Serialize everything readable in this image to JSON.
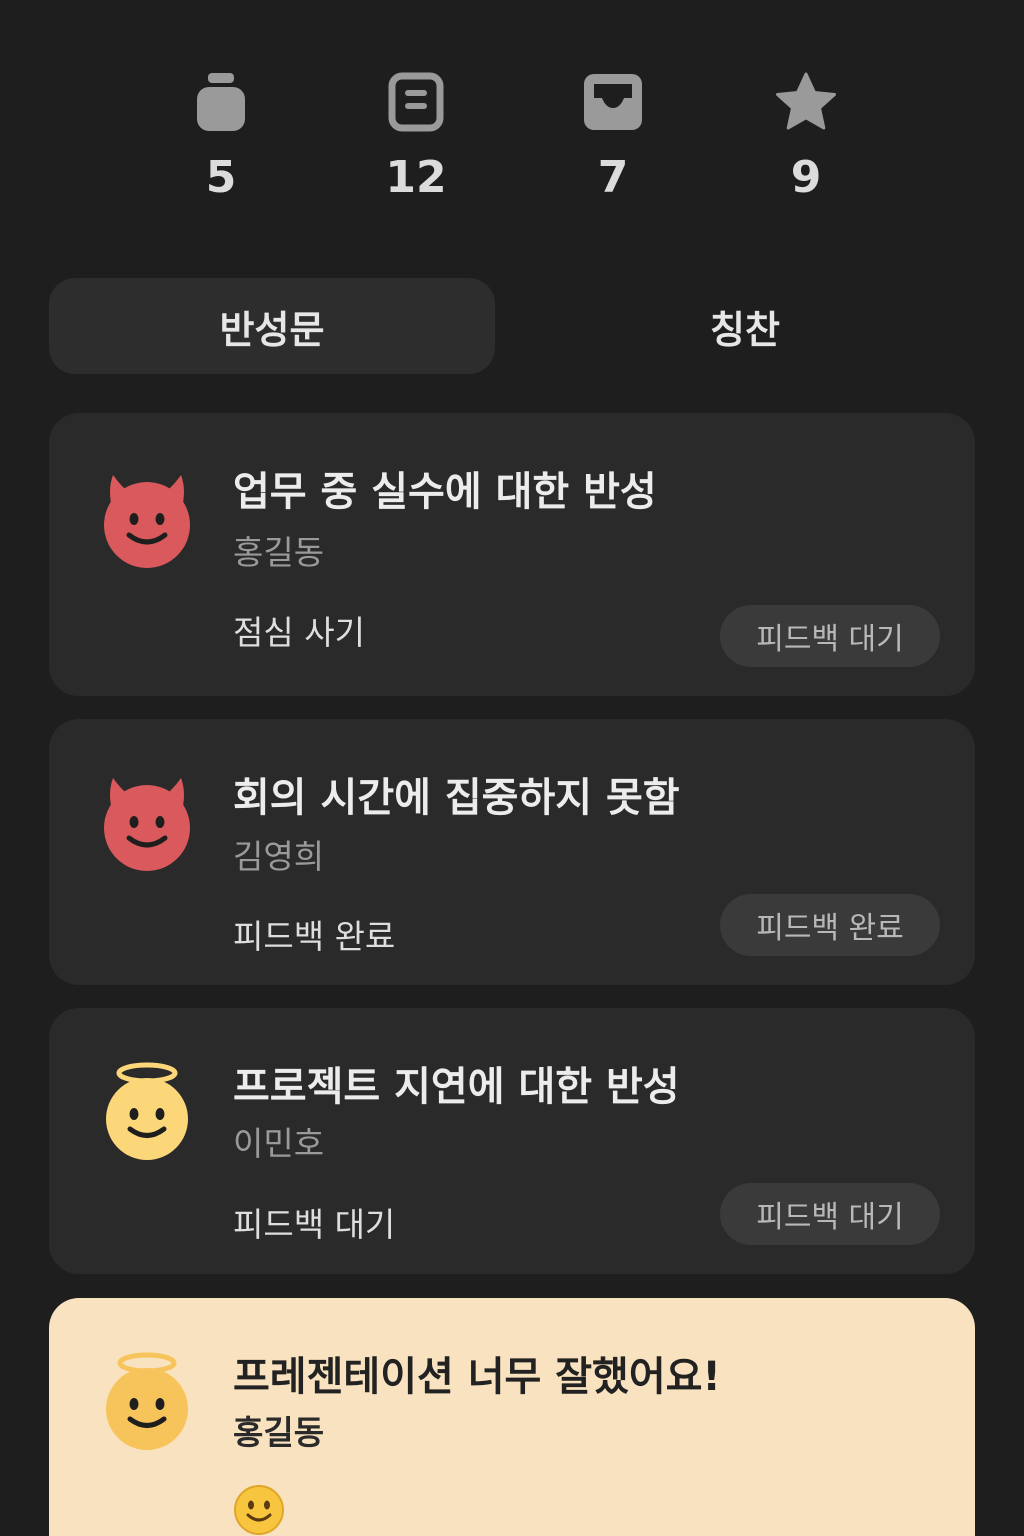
{
  "stats": [
    {
      "icon": "jar-icon",
      "count": "5"
    },
    {
      "icon": "note-icon",
      "count": "12"
    },
    {
      "icon": "inbox-icon",
      "count": "7"
    },
    {
      "icon": "star-icon",
      "count": "9"
    }
  ],
  "tabs": [
    {
      "label": "반성문",
      "active": true
    },
    {
      "label": "칭찬",
      "active": false
    }
  ],
  "cards": [
    {
      "type": "reflection",
      "face": "devil-face-icon",
      "title": "업무 중 실수에 대한 반성",
      "author": "홍길동",
      "note": "점심 사기",
      "status": "피드백 대기"
    },
    {
      "type": "reflection",
      "face": "devil-face-icon",
      "title": "회의 시간에 집중하지 못함",
      "author": "김영희",
      "note": "피드백 완료",
      "status": "피드백 완료"
    },
    {
      "type": "reflection",
      "face": "angel-face-icon",
      "title": "프로젝트 지연에 대한 반성",
      "author": "이민호",
      "note": "피드백 대기",
      "status": "피드백 대기"
    },
    {
      "type": "praise",
      "face": "angel-face-icon",
      "title": "프레젠테이션 너무 잘했어요!",
      "author": "홍길동",
      "reaction": "smiley-icon"
    }
  ],
  "colors": {
    "background": "#1e1e1e",
    "card": "#2a2a2a",
    "praise_card": "#f9e2bf",
    "devil": "#d9595c",
    "angel": "#fcd77a",
    "icon_gray": "#9a9a9a"
  }
}
